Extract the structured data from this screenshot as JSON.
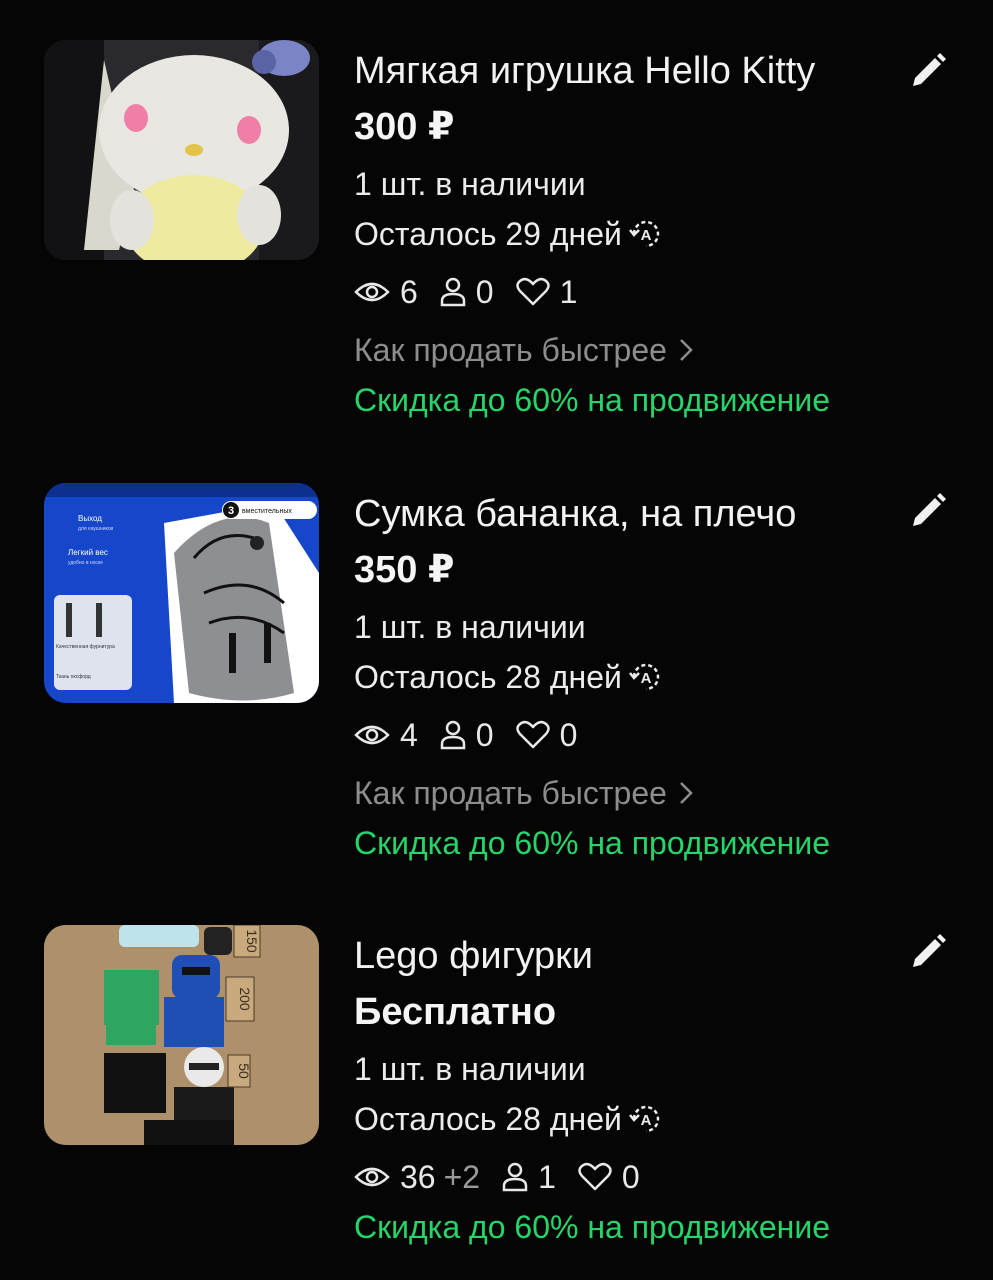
{
  "listings": [
    {
      "title": "Мягкая игрушка Hello Kitty",
      "price": "300 ₽",
      "stock": "1 шт. в наличии",
      "days_left": "Осталось 29 дней",
      "views": "6",
      "views_extra": "",
      "contacts": "0",
      "favorites": "1",
      "how_to_sell": "Как продать быстрее",
      "promo": "Скидка до 60% на продвижение",
      "thumb_icon": "hello-kitty-plush-photo"
    },
    {
      "title": "Сумка бананка, на плечо",
      "price": "350 ₽",
      "stock": "1 шт. в наличии",
      "days_left": "Осталось 28 дней",
      "views": "4",
      "views_extra": "",
      "contacts": "0",
      "favorites": "0",
      "how_to_sell": "Как продать быстрее",
      "promo": "Скидка до 60% на продвижение",
      "thumb_icon": "sling-bag-photo",
      "thumb_text": {
        "exit": "Выход",
        "exit_sub": "для наушников",
        "light": "Легкий вес",
        "light_sub": "удобно в носке",
        "compartments": "3",
        "compartments_sub": "вместительных",
        "quality": "Качественная фурнитура",
        "fabric": "Ткань оксфорд"
      }
    },
    {
      "title": "Lego фигурки",
      "price": "Бесплатно",
      "stock": "1 шт. в наличии",
      "days_left": "Осталось 28 дней",
      "views": "36",
      "views_extra": "+2",
      "contacts": "1",
      "favorites": "0",
      "how_to_sell": "",
      "promo": "Скидка до 60% на продвижение",
      "thumb_icon": "lego-figures-photo",
      "thumb_text": {
        "p1": "150",
        "p2": "200",
        "p3": "50"
      }
    }
  ],
  "colors": {
    "background": "#050505",
    "text": "#f2f2f2",
    "muted": "#8d8d8d",
    "promo_green": "#27d46a"
  }
}
